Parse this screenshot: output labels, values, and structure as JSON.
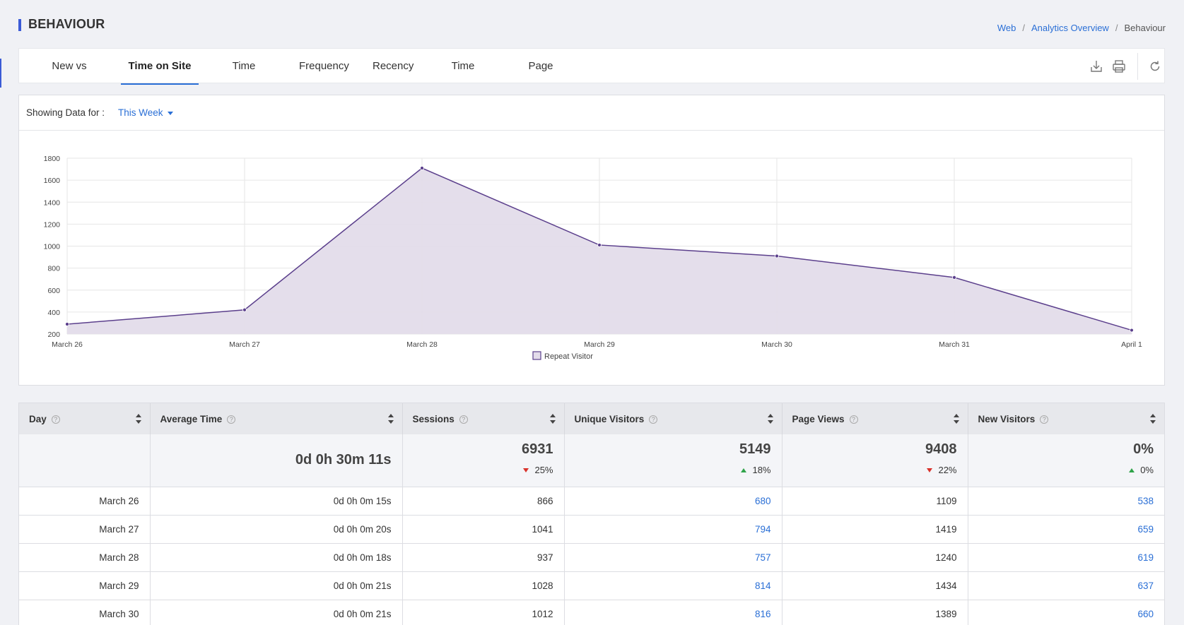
{
  "page": {
    "title": "BEHAVIOUR"
  },
  "breadcrumb": [
    {
      "label": "Web",
      "link": true
    },
    {
      "label": "Analytics Overview",
      "link": true
    },
    {
      "label": "Behaviour",
      "link": false
    }
  ],
  "tabs": [
    {
      "label": "New vs Return",
      "active": false
    },
    {
      "label": "Time on Site",
      "active": true
    },
    {
      "label": "Time Trends",
      "active": false
    },
    {
      "label": "Frequency",
      "active": false
    },
    {
      "label": "Recency",
      "active": false
    },
    {
      "label": "Time Spent",
      "active": false
    },
    {
      "label": "Page Depth",
      "active": false
    }
  ],
  "toolbar": {
    "icons": [
      "download-icon",
      "print-icon",
      "refresh-icon"
    ]
  },
  "filter": {
    "label": "Showing Data for :",
    "value": "This Week"
  },
  "chart_data": {
    "type": "area",
    "categories": [
      "March 26",
      "March 27",
      "March 28",
      "March 29",
      "March 30",
      "March 31",
      "April 1"
    ],
    "series": [
      {
        "name": "Repeat Visitor",
        "values": [
          290,
          420,
          1710,
          1010,
          910,
          715,
          235
        ]
      }
    ],
    "yticks": [
      200,
      400,
      600,
      800,
      1000,
      1200,
      1400,
      1600,
      1800
    ],
    "ylim": [
      200,
      1800
    ],
    "grid": true,
    "legend_position": "bottom",
    "colors": {
      "line": "#5b3f8c",
      "fill": "#e3dcea"
    }
  },
  "table": {
    "columns": [
      "Day",
      "Average Time",
      "Sessions",
      "Unique Visitors",
      "Page Views",
      "New Visitors"
    ],
    "summary": {
      "average_time": "0d 0h 30m 11s",
      "sessions": {
        "total": "6931",
        "change": "25%",
        "direction": "down"
      },
      "unique_visitors": {
        "total": "5149",
        "change": "18%",
        "direction": "up"
      },
      "page_views": {
        "total": "9408",
        "change": "22%",
        "direction": "down"
      },
      "new_visitors": {
        "total": "0%",
        "change": "0%",
        "direction": "up"
      }
    },
    "rows": [
      {
        "day": "March 26",
        "avg": "0d 0h 0m 15s",
        "sessions": "866",
        "unique": "680",
        "views": "1109",
        "new": "538"
      },
      {
        "day": "March 27",
        "avg": "0d 0h 0m 20s",
        "sessions": "1041",
        "unique": "794",
        "views": "1419",
        "new": "659"
      },
      {
        "day": "March 28",
        "avg": "0d 0h 0m 18s",
        "sessions": "937",
        "unique": "757",
        "views": "1240",
        "new": "619"
      },
      {
        "day": "March 29",
        "avg": "0d 0h 0m 21s",
        "sessions": "1028",
        "unique": "814",
        "views": "1434",
        "new": "637"
      },
      {
        "day": "March 30",
        "avg": "0d 0h 0m 21s",
        "sessions": "1012",
        "unique": "816",
        "views": "1389",
        "new": "660"
      }
    ]
  }
}
